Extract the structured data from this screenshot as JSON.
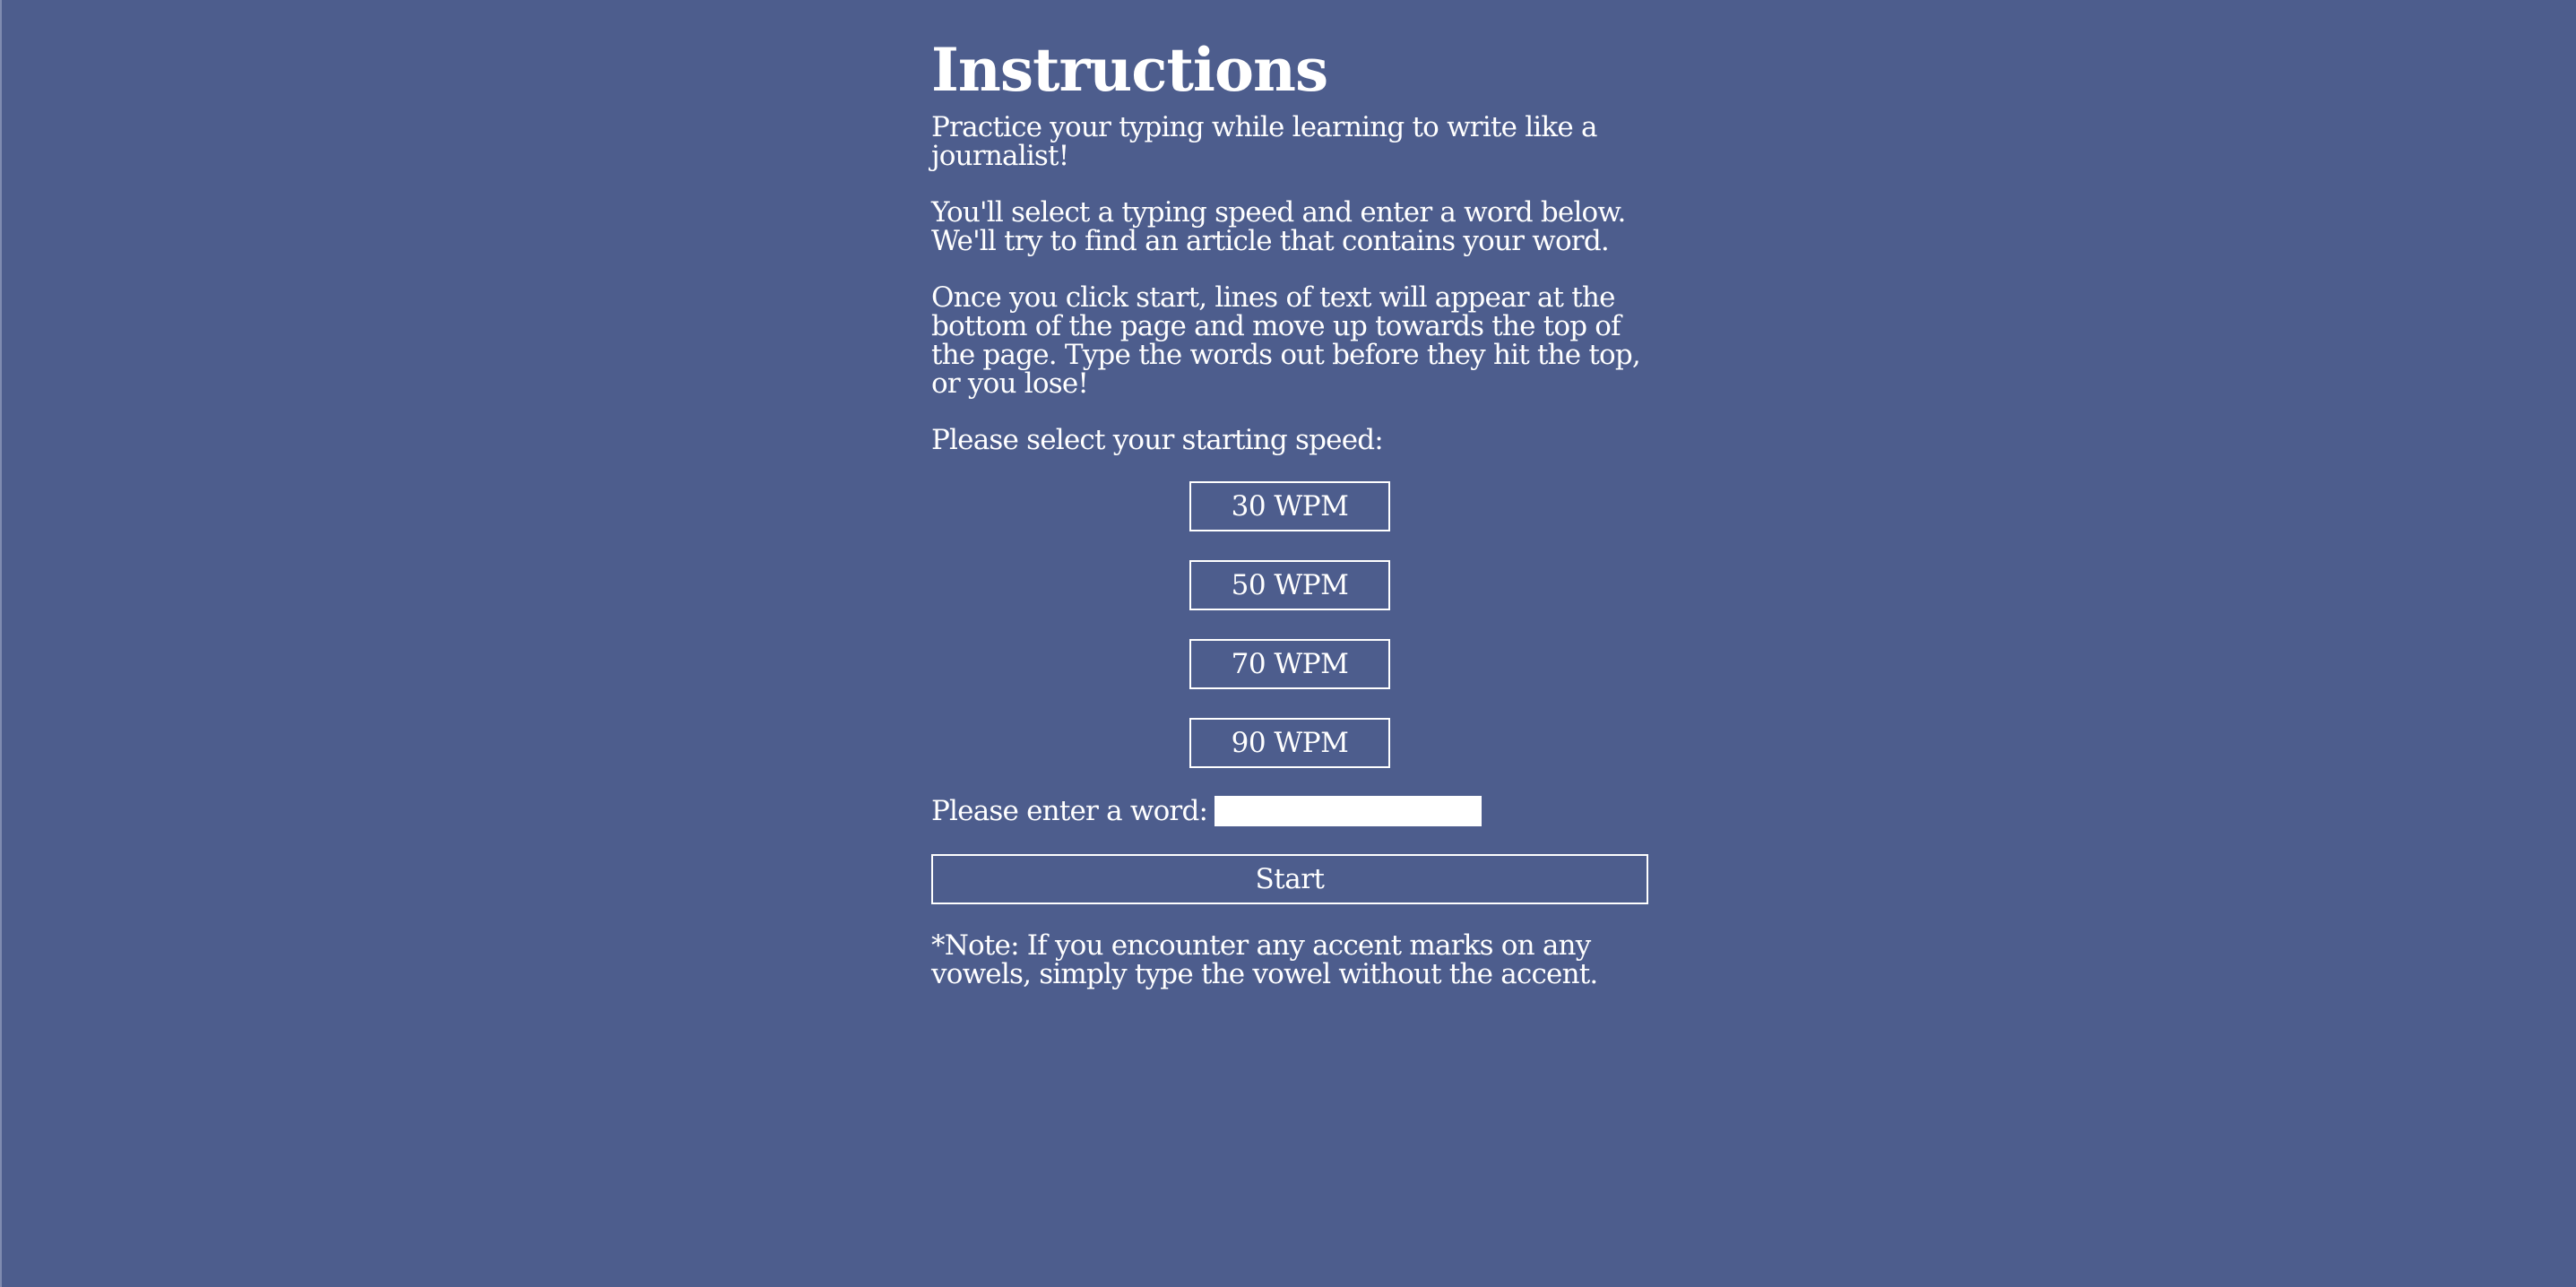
{
  "page": {
    "heading": "Instructions",
    "intro": "Practice your typing while learning to write like a journalist!",
    "explain": "You'll select a typing speed and enter a word below. We'll try to find an article that contains your word.",
    "howto": "Once you click start, lines of text will appear at the bottom of the page and move up towards the top of the page. Type the words out before they hit the top, or you lose!",
    "speed_prompt": "Please select your starting speed:"
  },
  "speeds": [
    {
      "label": "30 WPM"
    },
    {
      "label": "50 WPM"
    },
    {
      "label": "70 WPM"
    },
    {
      "label": "90 WPM"
    }
  ],
  "word": {
    "label": "Please enter a word:",
    "value": "",
    "placeholder": ""
  },
  "start_label": "Start",
  "note": "*Note: If you encounter any accent marks on any vowels, simply type the vowel without the accent.",
  "colors": {
    "background": "#4d5d8d",
    "text": "#ffffff"
  }
}
